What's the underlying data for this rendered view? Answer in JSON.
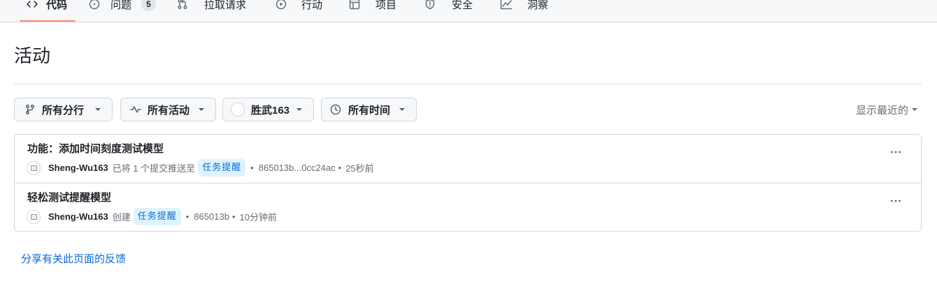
{
  "repo_nav": {
    "tabs": [
      {
        "label": "代码",
        "icon": "code-icon",
        "active": true
      },
      {
        "label": "问题",
        "icon": "issue-opened-icon",
        "counter": "5"
      },
      {
        "label": "拉取请求",
        "icon": "git-pull-request-icon"
      },
      {
        "label": "行动",
        "icon": "play-icon"
      },
      {
        "label": "项目",
        "icon": "table-icon"
      },
      {
        "label": "安全",
        "icon": "shield-icon"
      },
      {
        "label": "洞察",
        "icon": "graph-icon"
      }
    ]
  },
  "page": {
    "title": "活动"
  },
  "filters": {
    "branch": {
      "label": "所有分行",
      "icon": "git-branch-icon"
    },
    "activity": {
      "label": "所有活动",
      "icon": "pulse-icon"
    },
    "actor": {
      "label": "胜武163",
      "icon": "avatar"
    },
    "time": {
      "label": "所有时间",
      "icon": "clock-icon"
    },
    "sort": {
      "label": "显示最近的",
      "icon": "triangle-down-icon"
    }
  },
  "meta_separator": "•",
  "activities": [
    {
      "title": "功能：添加时间刻度测试模型",
      "actor": "Sheng-Wu163",
      "action": "已将 1 个提交推送至",
      "branch": "任务提醒",
      "commit": "865013b...0cc24ac",
      "time": "25秒前",
      "menu_icon": "kebab-horizontal-icon"
    },
    {
      "title": "轻松测试提醒模型",
      "actor": "Sheng-Wu163",
      "action": "创建",
      "branch": "任务提醒",
      "commit": "865013b",
      "time": "10分钟前",
      "menu_icon": "kebab-horizontal-icon"
    }
  ],
  "feedback": {
    "link_text": "分享有关此页面的反馈"
  },
  "colors": {
    "accent": "#fd8c73",
    "link": "#0969da",
    "text": "#1f2328",
    "muted": "#656d76",
    "border": "#d0d7de",
    "subtle_bg": "#f6f8fa",
    "badge_bg": "#ddf4ff"
  }
}
